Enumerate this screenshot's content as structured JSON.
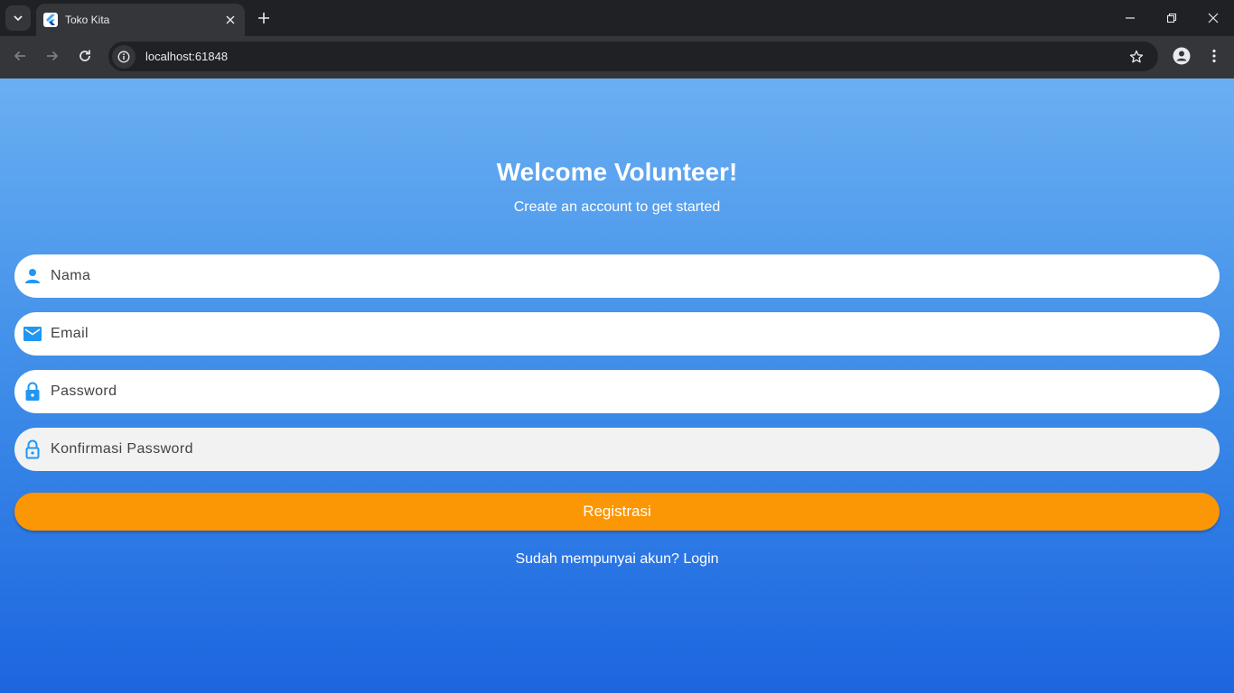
{
  "browser": {
    "tab_title": "Toko Kita",
    "url": "localhost:61848"
  },
  "icons": {
    "tab_search": "chevron-down-icon",
    "favicon": "flutter-icon",
    "tab_close": "close-icon",
    "new_tab": "plus-icon",
    "minimize": "minimize-icon",
    "restore": "restore-icon",
    "close_window": "close-icon",
    "back": "arrow-left-icon",
    "forward": "arrow-right-icon",
    "reload": "reload-icon",
    "site_info": "info-icon",
    "bookmark": "star-icon",
    "profile": "person-icon",
    "menu": "kebab-menu-icon",
    "field_nama": "person-icon",
    "field_email": "mail-icon",
    "field_password": "lock-icon",
    "field_konfirmasi": "lock-outline-icon"
  },
  "colors": {
    "accent": "#2196f3",
    "button": "#fb9604",
    "gradient_top": "#6aaff2",
    "gradient_bottom": "#1c65e0"
  },
  "page": {
    "title": "Welcome Volunteer!",
    "subtitle": "Create an account to get started",
    "fields": [
      {
        "placeholder": "Nama",
        "value": ""
      },
      {
        "placeholder": "Email",
        "value": ""
      },
      {
        "placeholder": "Password",
        "value": ""
      },
      {
        "placeholder": "Konfirmasi Password",
        "value": ""
      }
    ],
    "register_label": "Registrasi",
    "login_prompt": "Sudah mempunyai akun? Login"
  }
}
